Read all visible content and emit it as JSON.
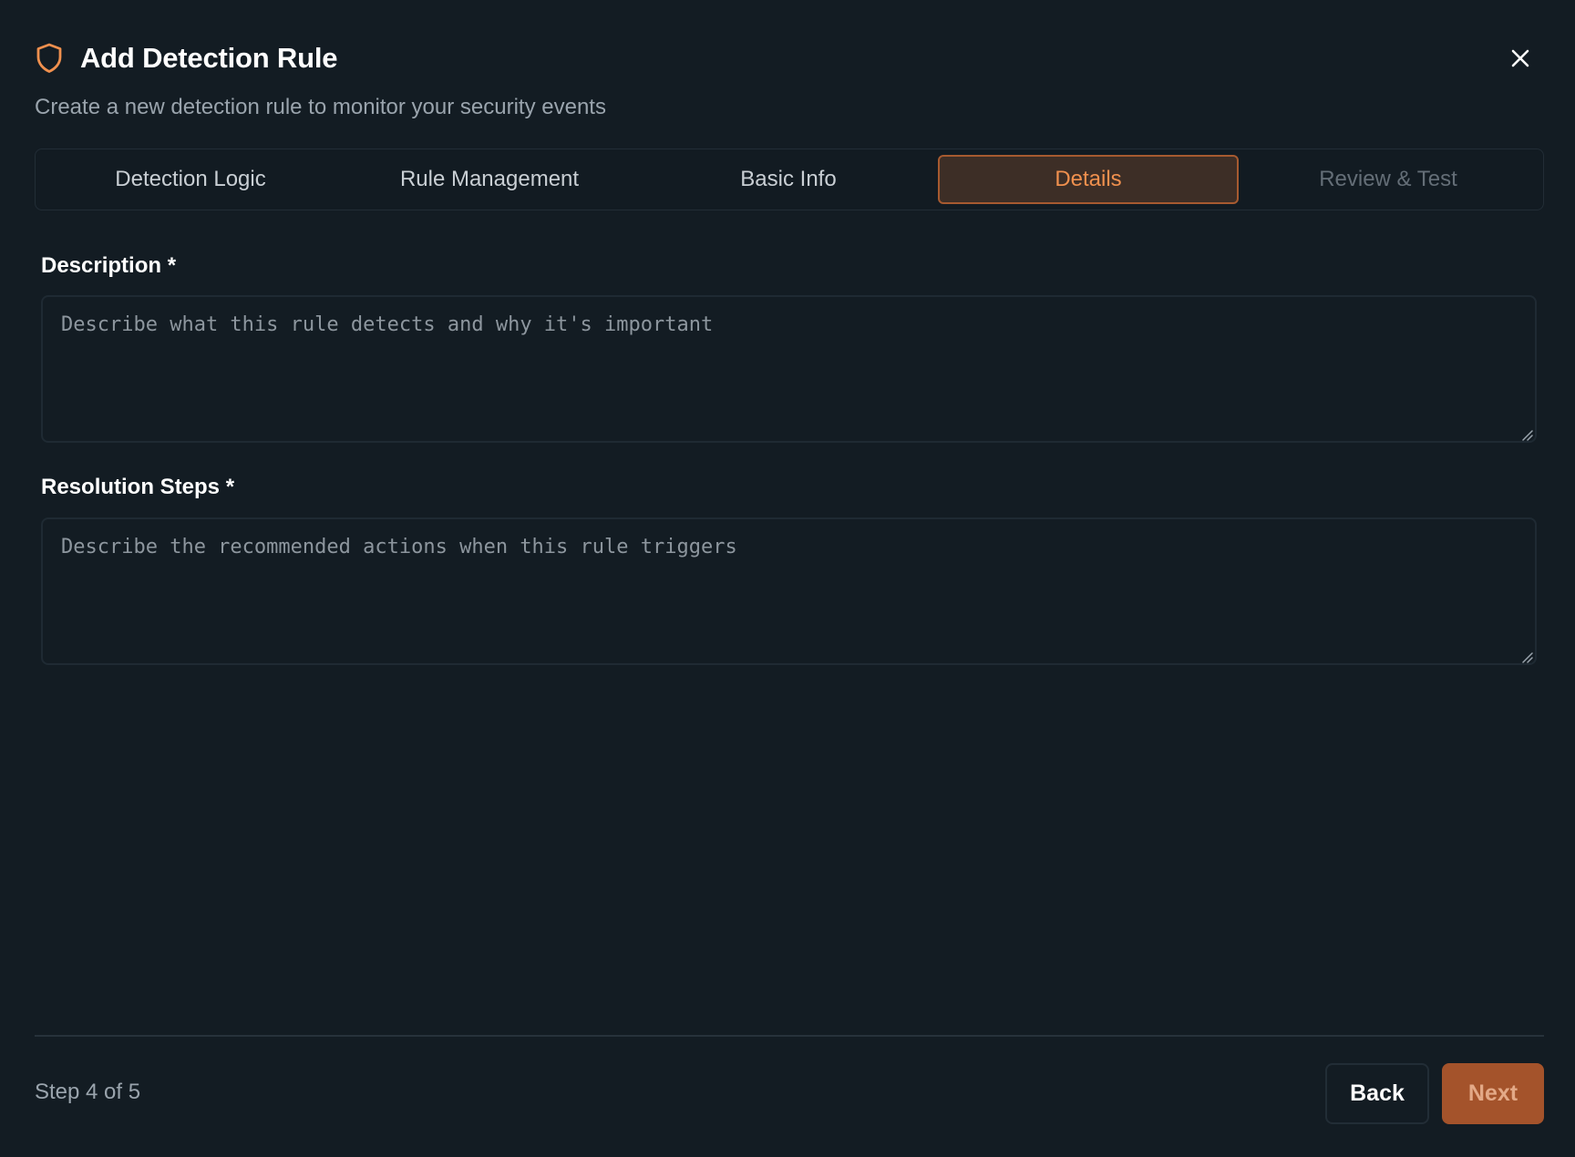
{
  "dialog": {
    "title": "Add Detection Rule",
    "subtitle": "Create a new detection rule to monitor your security events",
    "icon": "shield-icon",
    "accent_color": "#f0904e"
  },
  "tabs": [
    {
      "label": "Detection Logic",
      "state": "normal"
    },
    {
      "label": "Rule Management",
      "state": "normal"
    },
    {
      "label": "Basic Info",
      "state": "normal"
    },
    {
      "label": "Details",
      "state": "active"
    },
    {
      "label": "Review & Test",
      "state": "disabled"
    }
  ],
  "fields": {
    "description": {
      "label": "Description *",
      "value": "",
      "placeholder": "Describe what this rule detects and why it's important"
    },
    "resolution": {
      "label": "Resolution Steps *",
      "value": "",
      "placeholder": "Describe the recommended actions when this rule triggers"
    }
  },
  "footer": {
    "step_text": "Step 4 of 5",
    "back_label": "Back",
    "next_label": "Next"
  }
}
